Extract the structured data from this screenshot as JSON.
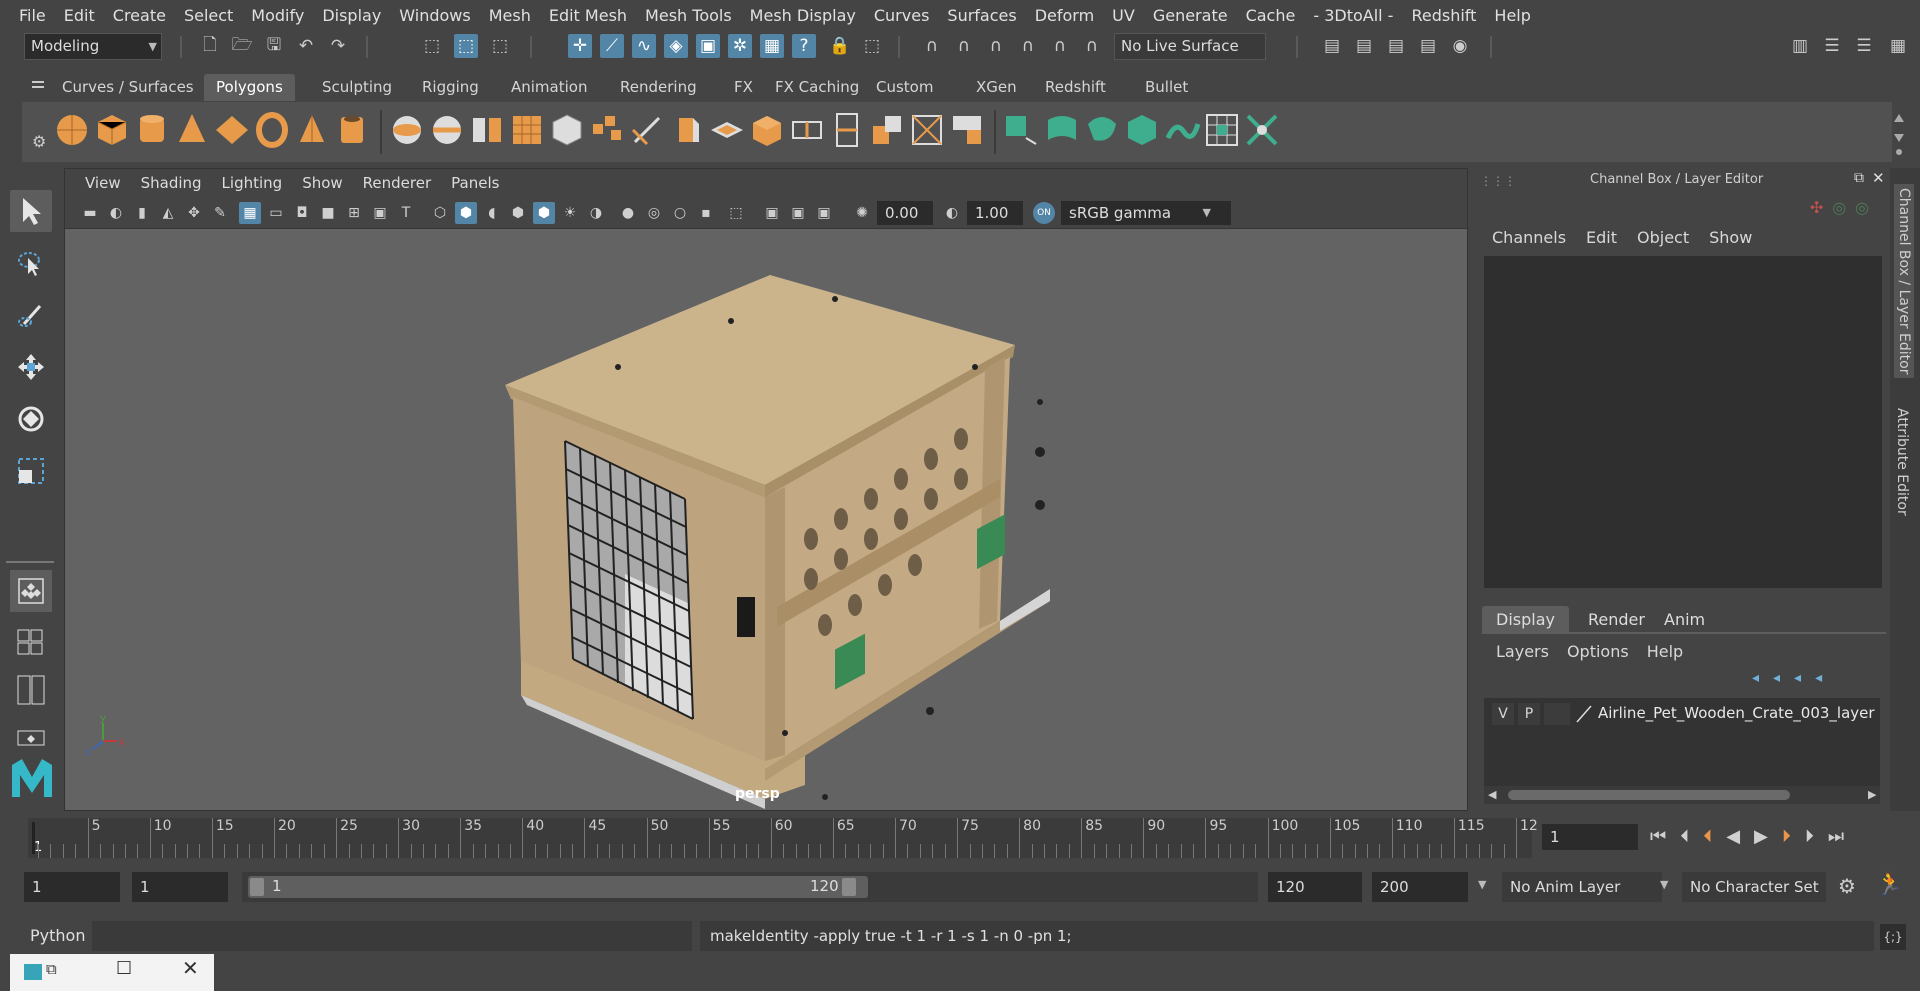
{
  "menubar": {
    "items": [
      "File",
      "Edit",
      "Create",
      "Select",
      "Modify",
      "Display",
      "Windows",
      "Mesh",
      "Edit Mesh",
      "Mesh Tools",
      "Mesh Display",
      "Curves",
      "Surfaces",
      "Deform",
      "UV",
      "Generate",
      "Cache",
      "- 3DtoAll -",
      "Redshift",
      "Help"
    ]
  },
  "statusline": {
    "mode": "Modeling",
    "live_surface": "No Live Surface"
  },
  "shelf": {
    "tabs": [
      "Curves / Surfaces",
      "Polygons",
      "Sculpting",
      "Rigging",
      "Animation",
      "Rendering",
      "FX",
      "FX Caching",
      "Custom",
      "XGen",
      "Redshift",
      "Bullet"
    ],
    "active_tab": "Polygons"
  },
  "viewport": {
    "menu": [
      "View",
      "Shading",
      "Lighting",
      "Show",
      "Renderer",
      "Panels"
    ],
    "exposure": "0.00",
    "gamma": "1.00",
    "color_space": "sRGB gamma",
    "camera": "persp"
  },
  "right_panel": {
    "title": "Channel Box / Layer Editor",
    "channel_menu": [
      "Channels",
      "Edit",
      "Object",
      "Show"
    ],
    "layer_tabs": [
      "Display",
      "Render",
      "Anim"
    ],
    "layer_menu": [
      "Layers",
      "Options",
      "Help"
    ],
    "layer": {
      "v": "V",
      "p": "P",
      "name": "Airline_Pet_Wooden_Crate_003_layer"
    },
    "side_tabs": [
      "Channel Box / Layer Editor",
      "Attribute Editor"
    ]
  },
  "timeline": {
    "start_marker": "1",
    "ticks": [
      "5",
      "10",
      "15",
      "20",
      "25",
      "30",
      "35",
      "40",
      "45",
      "50",
      "55",
      "60",
      "65",
      "70",
      "75",
      "80",
      "85",
      "90",
      "95",
      "100",
      "105",
      "110",
      "115",
      "12"
    ],
    "current_frame": "1"
  },
  "range": {
    "start": "1",
    "playback_start": "1",
    "slider_start": "1",
    "slider_end": "120",
    "playback_end": "120",
    "end": "200",
    "anim_layer": "No Anim Layer",
    "character_set": "No Character Set"
  },
  "command": {
    "language": "Python",
    "result": "makeIdentity -apply true -t 1 -r 1 -s 1 -n 0 -pn 1;"
  },
  "colors": {
    "accent": "#5285a6",
    "shelf_icon_orange": "#e79a4a",
    "shelf_icon_green": "#3fae8e",
    "crate_wood": "#c8b08a"
  }
}
